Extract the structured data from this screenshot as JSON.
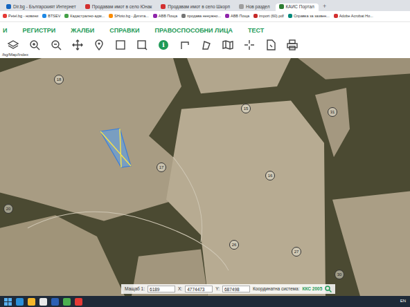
{
  "browser": {
    "tabs": [
      {
        "label": "Dir.bg - Българският Интернет",
        "selected": false
      },
      {
        "label": "Продавам имот в село Юнак",
        "selected": false
      },
      {
        "label": "Продавам имот в село Шкорп",
        "selected": false
      },
      {
        "label": "Нов раздел",
        "selected": false
      },
      {
        "label": "КАИС Портал",
        "selected": true
      }
    ],
    "new_tab": "+",
    "bookmarks": [
      "Petel.bg - новини",
      "BTSEV",
      "Кадастрално-адм...",
      "SHoto.bg - Дигита...",
      "ABB Поща",
      "продава ненужно...",
      "ABB Поща",
      "import (60).pdf",
      "Справка за зазвен...",
      "Adobe Acrobat Ho..."
    ]
  },
  "menu": [
    "И",
    "РЕГИСТРИ",
    "ЖАЛБИ",
    "СПРАВКИ",
    "ПРАВОСПОСОБНИ ЛИЦА",
    "ТЕСТ"
  ],
  "toolbar": [
    {
      "kind": "icon",
      "selected": false
    },
    {
      "kind": "icon",
      "selected": false
    },
    {
      "kind": "icon",
      "selected": false
    },
    {
      "kind": "icon",
      "selected": false
    },
    {
      "kind": "icon",
      "selected": false
    },
    {
      "kind": "icon",
      "selected": false
    },
    {
      "kind": "icon",
      "selected": false
    },
    {
      "kind": "glyph",
      "text": "i",
      "selected": true
    },
    {
      "kind": "icon",
      "selected": false
    },
    {
      "kind": "icon",
      "selected": false
    },
    {
      "kind": "icon",
      "selected": false
    },
    {
      "kind": "icon",
      "selected": false
    },
    {
      "kind": "icon",
      "selected": false
    },
    {
      "kind": "icon",
      "selected": false
    }
  ],
  "status_url": "/bg/Map/Index",
  "map": {
    "parcels": [
      {
        "label": "18"
      },
      {
        "label": "15"
      },
      {
        "label": "31"
      },
      {
        "label": "17"
      },
      {
        "label": "16"
      },
      {
        "label": "20"
      },
      {
        "label": "26"
      },
      {
        "label": "27"
      },
      {
        "label": "30"
      }
    ],
    "selected_parcel": {
      "selected": true
    }
  },
  "coords": {
    "scale_label": "Мащаб 1:",
    "scale": "6189",
    "x_label": "X:",
    "x": "4774473",
    "y_label": "Y:",
    "y": "687498",
    "system_label": "Координатна система:",
    "system": "ККС 2005"
  },
  "taskbar": {
    "language": "EN"
  }
}
